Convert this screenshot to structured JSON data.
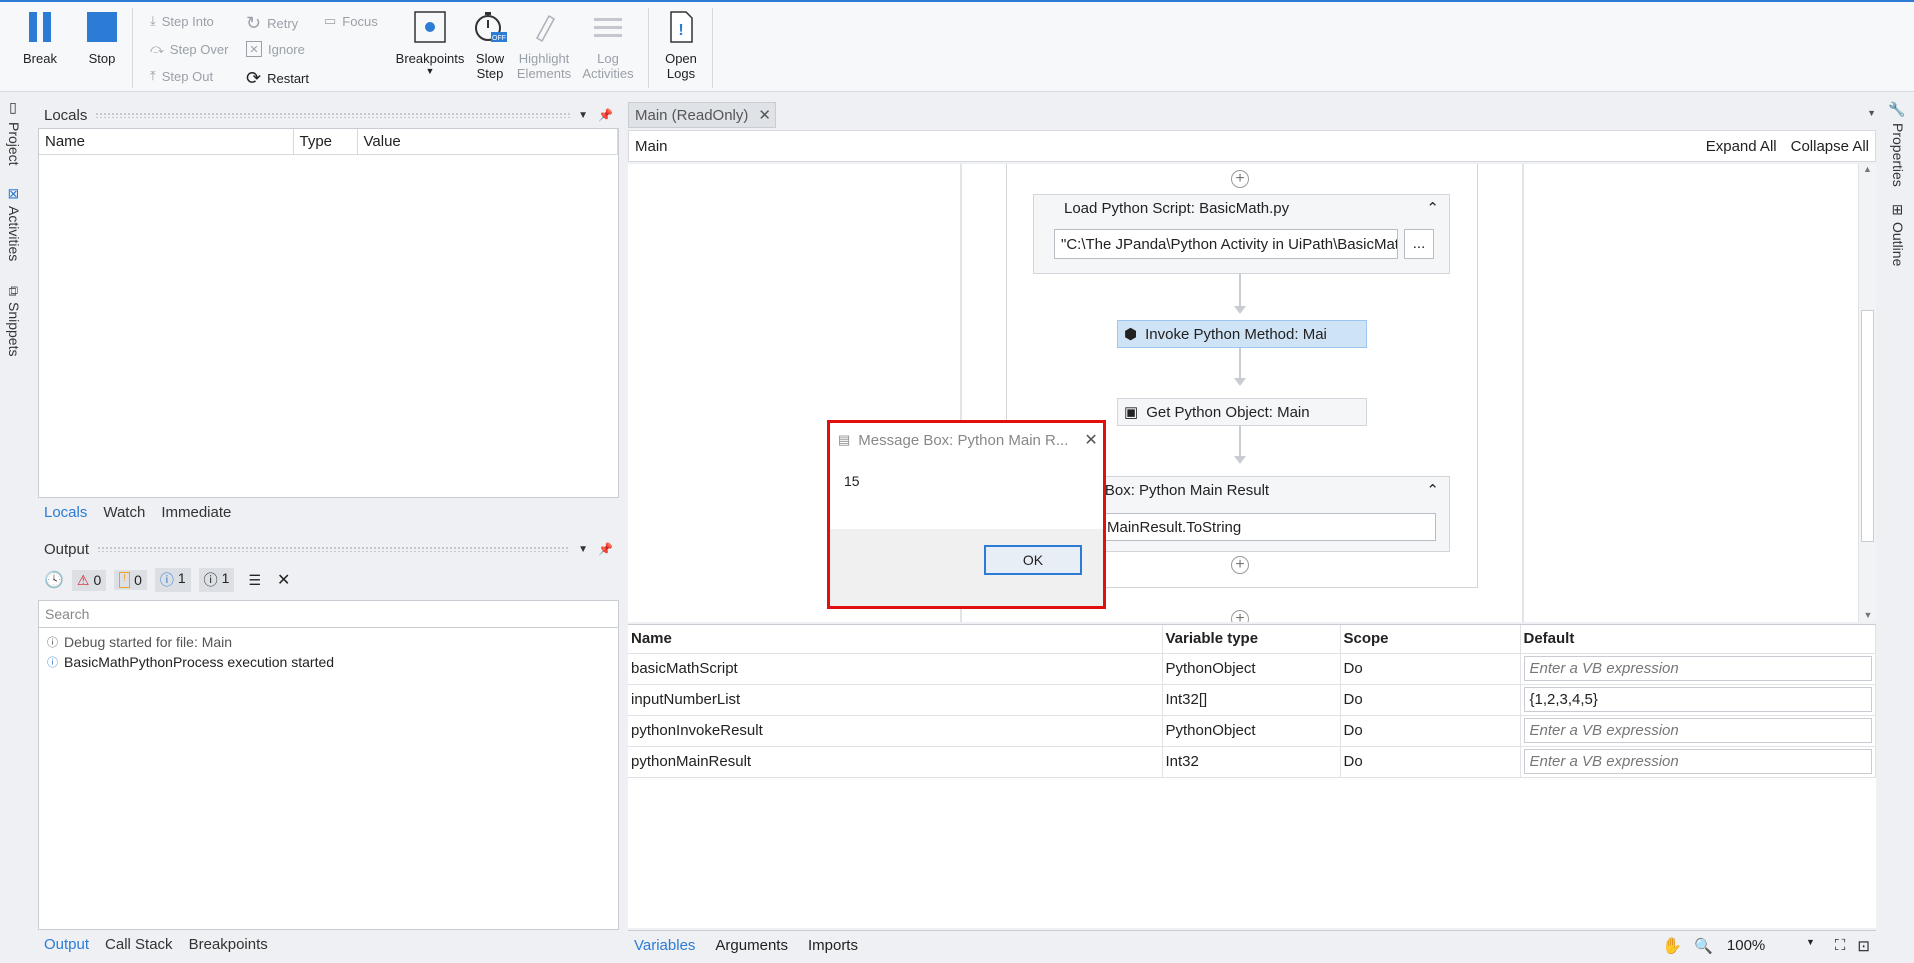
{
  "ribbon": {
    "break": "Break",
    "stop": "Stop",
    "step_into": "Step Into",
    "step_over": "Step Over",
    "step_out": "Step Out",
    "retry": "Retry",
    "ignore": "Ignore",
    "restart": "Restart",
    "focus": "Focus",
    "breakpoints": "Breakpoints",
    "slow_step_1": "Slow",
    "slow_step_2": "Step",
    "highlight_1": "Highlight",
    "highlight_2": "Elements",
    "log_1": "Log",
    "log_2": "Activities",
    "open_logs_1": "Open",
    "open_logs_2": "Logs",
    "off_badge": "OFF"
  },
  "left_strip": {
    "project": "Project",
    "activities": "Activities",
    "snippets": "Snippets"
  },
  "right_strip": {
    "properties": "Properties",
    "outline": "Outline"
  },
  "locals": {
    "title": "Locals",
    "columns": [
      "Name",
      "Type",
      "Value"
    ],
    "tabs": [
      "Locals",
      "Watch",
      "Immediate"
    ]
  },
  "output": {
    "title": "Output",
    "counts": {
      "errors": "0",
      "warnings": "0",
      "info": "1",
      "trace": "1"
    },
    "search_placeholder": "Search",
    "lines": [
      "Debug started for file: Main",
      "BasicMathPythonProcess execution started"
    ],
    "tabs": [
      "Output",
      "Call Stack",
      "Breakpoints"
    ]
  },
  "designer": {
    "tab": "Main (ReadOnly)",
    "breadcrumb": "Main",
    "expand_all": "Expand All",
    "collapse_all": "Collapse All",
    "load_script_title": "Load Python Script: BasicMath.py",
    "load_script_path": "\"C:\\The JPanda\\Python Activity in UiPath\\BasicMat",
    "browse": "...",
    "invoke_method": "Invoke Python Method: Mai",
    "get_object": "Get Python Object: Main",
    "msgbox_title": "ge Box: Python Main Result",
    "msgbox_expr": "MainResult.ToString"
  },
  "variables": {
    "columns": [
      "Name",
      "Variable type",
      "Scope",
      "Default"
    ],
    "rows": [
      {
        "name": "basicMathScript",
        "type": "PythonObject",
        "scope": "Do",
        "default": "Enter a VB expression",
        "placeholder": true
      },
      {
        "name": "inputNumberList",
        "type": "Int32[]",
        "scope": "Do",
        "default": "{1,2,3,4,5}",
        "placeholder": false
      },
      {
        "name": "pythonInvokeResult",
        "type": "PythonObject",
        "scope": "Do",
        "default": "Enter a VB expression",
        "placeholder": true
      },
      {
        "name": "pythonMainResult",
        "type": "Int32",
        "scope": "Do",
        "default": "Enter a VB expression",
        "placeholder": true
      }
    ],
    "tabs": [
      "Variables",
      "Arguments",
      "Imports"
    ],
    "zoom": "100%"
  },
  "dialog": {
    "title": "Message Box: Python Main R...",
    "message": "15",
    "ok": "OK"
  },
  "colors": {
    "accent": "#2c7bd4",
    "highlight_red": "#e01010",
    "selected_activity": "#cfe3f7"
  }
}
